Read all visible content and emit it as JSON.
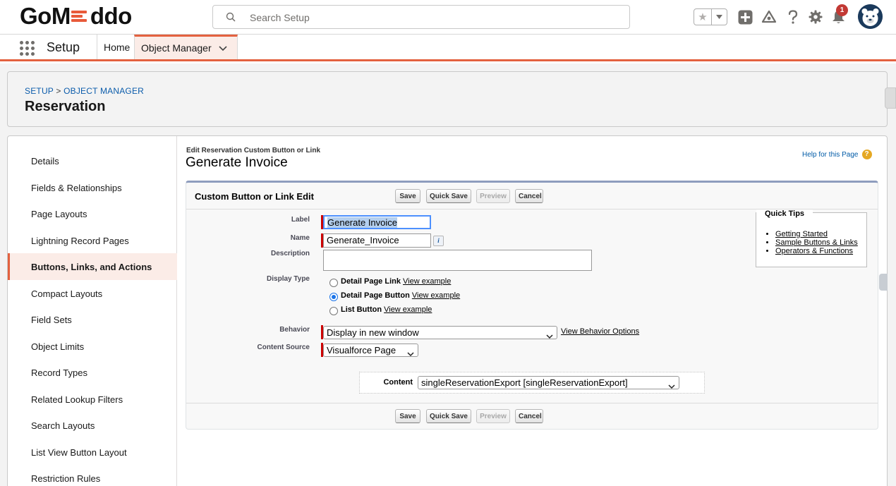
{
  "header": {
    "logo": "GoMeddo",
    "logo_left": "GoM",
    "logo_right": "ddo",
    "search_placeholder": "Search Setup",
    "notification_count": "1",
    "icons": [
      "star-icon",
      "chevron-down-icon",
      "plus-icon",
      "trailhead-icon",
      "help-icon",
      "gear-icon",
      "bell-icon",
      "avatar"
    ]
  },
  "nav": {
    "app_name": "Setup",
    "tabs": [
      {
        "label": "Home"
      },
      {
        "label": "Object Manager",
        "active": true
      }
    ]
  },
  "page_header": {
    "breadcrumb_setup": "SETUP",
    "breadcrumb_sep": ">",
    "breadcrumb_object_manager": "OBJECT MANAGER",
    "title": "Reservation"
  },
  "left_nav": {
    "items": [
      {
        "label": "Details"
      },
      {
        "label": "Fields & Relationships"
      },
      {
        "label": "Page Layouts"
      },
      {
        "label": "Lightning Record Pages"
      },
      {
        "label": "Buttons, Links, and Actions",
        "selected": true
      },
      {
        "label": "Compact Layouts"
      },
      {
        "label": "Field Sets"
      },
      {
        "label": "Object Limits"
      },
      {
        "label": "Record Types"
      },
      {
        "label": "Related Lookup Filters"
      },
      {
        "label": "Search Layouts"
      },
      {
        "label": "List View Button Layout"
      },
      {
        "label": "Restriction Rules"
      }
    ]
  },
  "content": {
    "context_title": "Edit Reservation Custom Button or Link",
    "title": "Generate Invoice",
    "help_link": "Help for this Page",
    "block_title": "Custom Button or Link Edit",
    "buttons": {
      "save": "Save",
      "quick_save": "Quick Save",
      "preview": "Preview",
      "cancel": "Cancel"
    },
    "form": {
      "label_label": "Label",
      "label_value": "Generate Invoice",
      "name_label": "Name",
      "name_value": "Generate_Invoice",
      "info_icon": "i",
      "description_label": "Description",
      "description_value": "",
      "display_type_label": "Display Type",
      "display_types": [
        {
          "label": "Detail Page Link",
          "link": "View example",
          "checked": false
        },
        {
          "label": "Detail Page Button",
          "link": "View example",
          "checked": true
        },
        {
          "label": "List Button",
          "link": "View example",
          "checked": false
        }
      ],
      "behavior_label": "Behavior",
      "behavior_value": "Display in new window",
      "behavior_link": "View Behavior Options",
      "content_source_label": "Content Source",
      "content_source_value": "Visualforce Page",
      "content_label": "Content",
      "content_value": "singleReservationExport [singleReservationExport]"
    },
    "quick_tips": {
      "title": "Quick Tips",
      "links": [
        "Getting Started",
        "Sample Buttons & Links",
        "Operators & Functions"
      ]
    }
  },
  "colors": {
    "accent": "#e3613f",
    "link": "#0b5cab",
    "required": "#cc0000",
    "selected_bg": "#fbece7"
  }
}
